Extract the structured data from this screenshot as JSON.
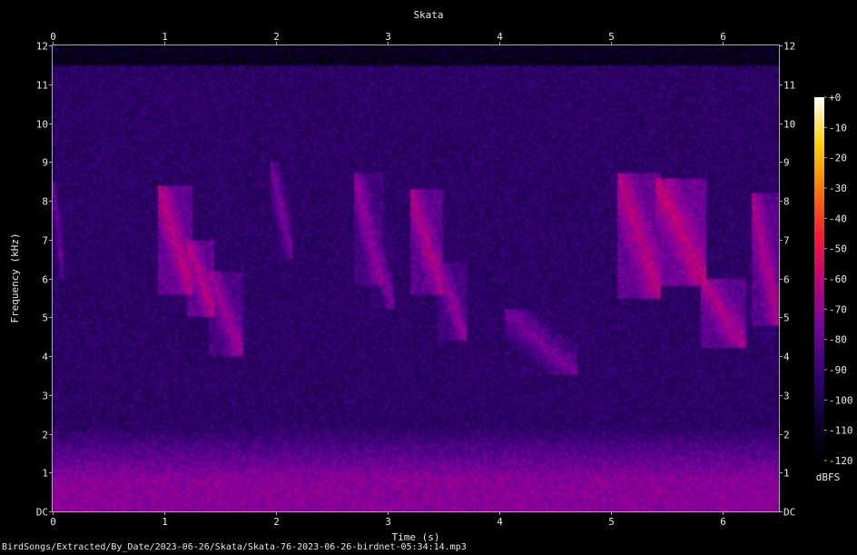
{
  "chart_data": {
    "type": "heatmap",
    "title": "Skata",
    "xlabel": "Time (s)",
    "ylabel": "Frequency (kHz)",
    "xlim": [
      0,
      6.5
    ],
    "ylim": [
      0,
      12
    ],
    "x_ticks": [
      0,
      1,
      2,
      3,
      4,
      5,
      6
    ],
    "x_tick_labels": [
      "0",
      "1",
      "2",
      "3",
      "4",
      "5",
      "6"
    ],
    "y_ticks": [
      0,
      1,
      2,
      3,
      4,
      5,
      6,
      7,
      8,
      9,
      10,
      11,
      12
    ],
    "y_tick_labels": [
      "DC",
      "1",
      "2",
      "3",
      "4",
      "5",
      "6",
      "7",
      "8",
      "9",
      "10",
      "11",
      "12"
    ],
    "colorbar": {
      "label": "dBFS",
      "range": [
        -120,
        0
      ],
      "ticks": [
        0,
        -10,
        -20,
        -30,
        -40,
        -50,
        -60,
        -70,
        -80,
        -90,
        -100,
        -110,
        -120
      ],
      "tick_labels": [
        "+0",
        "-10",
        "-20",
        "-30",
        "-40",
        "-50",
        "-60",
        "-70",
        "-80",
        "-90",
        "-100",
        "-110",
        "-120"
      ],
      "colors": [
        "#000000",
        "#10003a",
        "#3a007a",
        "#7a00a0",
        "#c0007a",
        "#ff1a33",
        "#ff7a00",
        "#ffd200",
        "#ffffff"
      ]
    },
    "background_level_dbfs": -95,
    "low_band": {
      "freq_khz": [
        0,
        2.2
      ],
      "level_dbfs": -72
    },
    "calls": [
      {
        "t": [
          0.0,
          0.1
        ],
        "f": [
          6.0,
          8.5
        ],
        "level_dbfs": -78
      },
      {
        "t": [
          0.95,
          1.25
        ],
        "f": [
          5.6,
          8.4
        ],
        "level_dbfs": -62
      },
      {
        "t": [
          1.2,
          1.45
        ],
        "f": [
          5.0,
          7.0
        ],
        "level_dbfs": -62
      },
      {
        "t": [
          1.4,
          1.7
        ],
        "f": [
          4.0,
          6.2
        ],
        "level_dbfs": -68
      },
      {
        "t": [
          1.95,
          2.15
        ],
        "f": [
          6.5,
          9.0
        ],
        "level_dbfs": -76
      },
      {
        "t": [
          2.7,
          2.95
        ],
        "f": [
          5.8,
          8.7
        ],
        "level_dbfs": -70
      },
      {
        "t": [
          2.85,
          3.05
        ],
        "f": [
          5.2,
          7.2
        ],
        "level_dbfs": -74
      },
      {
        "t": [
          3.2,
          3.5
        ],
        "f": [
          5.6,
          8.3
        ],
        "level_dbfs": -64
      },
      {
        "t": [
          3.45,
          3.7
        ],
        "f": [
          4.4,
          6.4
        ],
        "level_dbfs": -70
      },
      {
        "t": [
          4.05,
          4.7
        ],
        "f": [
          3.5,
          5.2
        ],
        "level_dbfs": -76
      },
      {
        "t": [
          5.05,
          5.45
        ],
        "f": [
          5.5,
          8.7
        ],
        "level_dbfs": -62
      },
      {
        "t": [
          5.4,
          5.85
        ],
        "f": [
          5.8,
          8.6
        ],
        "level_dbfs": -60
      },
      {
        "t": [
          5.8,
          6.2
        ],
        "f": [
          4.2,
          6.0
        ],
        "level_dbfs": -64
      },
      {
        "t": [
          6.25,
          6.5
        ],
        "f": [
          4.8,
          8.2
        ],
        "level_dbfs": -64
      }
    ]
  },
  "footer_path": "BirdSongs/Extracted/By_Date/2023-06-26/Skata/Skata-76-2023-06-26-birdnet-05:34:14.mp3"
}
